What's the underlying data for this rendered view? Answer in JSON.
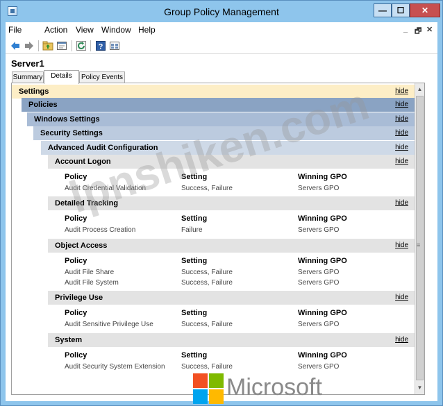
{
  "window": {
    "title": "Group Policy Management",
    "controls": {
      "minimize": "—",
      "maximize": "☐",
      "close": "✕"
    },
    "accent_color": "#8ec5ec"
  },
  "menu": {
    "items": [
      "File",
      "Action",
      "View",
      "Window",
      "Help"
    ],
    "mdi_controls": {
      "minimize": "_",
      "restore": "🗗",
      "close": "✕"
    }
  },
  "toolbar": {
    "icons": [
      "back-arrow-icon",
      "forward-arrow-icon",
      "up-folder-icon",
      "properties-icon",
      "refresh-icon",
      "help-icon",
      "view-icon"
    ]
  },
  "server": {
    "title": "Server1"
  },
  "tabs": [
    "Summary",
    "Details",
    "Policy Events"
  ],
  "report": {
    "hide_label": "hide",
    "settings_label": "Settings",
    "policies_label": "Policies",
    "windows_settings_label": "Windows Settings",
    "security_settings_label": "Security Settings",
    "advanced_audit_label": "Advanced Audit Configuration",
    "columns": {
      "policy": "Policy",
      "setting": "Setting",
      "winning_gpo": "Winning GPO"
    },
    "categories": [
      {
        "name": "Account Logon",
        "rows": [
          {
            "policy": "Audit Credential Validation",
            "setting": "Success, Failure",
            "gpo": "Servers GPO"
          }
        ]
      },
      {
        "name": "Detailed Tracking",
        "rows": [
          {
            "policy": "Audit Process Creation",
            "setting": "Failure",
            "gpo": "Servers GPO"
          }
        ]
      },
      {
        "name": "Object Access",
        "rows": [
          {
            "policy": "Audit File Share",
            "setting": "Success, Failure",
            "gpo": "Servers GPO"
          },
          {
            "policy": "Audit File System",
            "setting": "Success, Failure",
            "gpo": "Servers GPO"
          }
        ]
      },
      {
        "name": "Privilege Use",
        "rows": [
          {
            "policy": "Audit Sensitive Privilege Use",
            "setting": "Success, Failure",
            "gpo": "Servers GPO"
          }
        ]
      },
      {
        "name": "System",
        "rows": [
          {
            "policy": "Audit Security System Extension",
            "setting": "Success, Failure",
            "gpo": "Servers GPO"
          }
        ]
      }
    ]
  },
  "watermark": "lpnshiken.com",
  "brand": {
    "text": "Microsoft",
    "colors": {
      "red": "#f25022",
      "green": "#7fba00",
      "blue": "#00a4ef",
      "yellow": "#ffb900"
    }
  }
}
